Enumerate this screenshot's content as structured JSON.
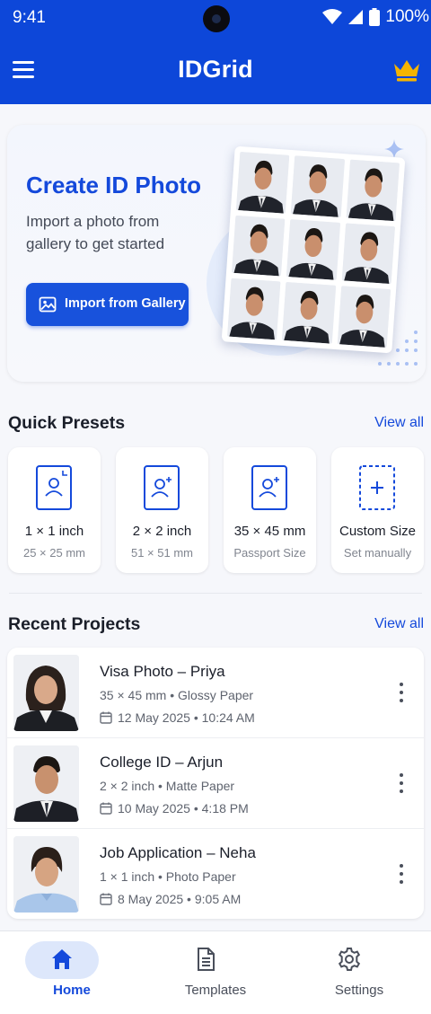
{
  "status": {
    "time": "9:41",
    "battery": "100%"
  },
  "app": {
    "title": "IDGrid"
  },
  "hero": {
    "title": "Create ID Photo",
    "subtitle": "Import a photo from gallery to get started",
    "button_label": "Import from Gallery"
  },
  "quick_presets": {
    "title": "Quick Presets",
    "view_all": "View all",
    "items": [
      {
        "label": "1 × 1 inch",
        "sub": "25 × 25 mm",
        "icon": "portrait-card-icon"
      },
      {
        "label": "2 × 2 inch",
        "sub": "51 × 51 mm",
        "icon": "portrait-add-icon"
      },
      {
        "label": "35 × 45 mm",
        "sub": "Passport Size",
        "icon": "passport-portrait-icon"
      },
      {
        "label": "Custom Size",
        "sub": "Set manually",
        "icon": "dashed-plus-icon"
      }
    ]
  },
  "recent_projects": {
    "title": "Recent Projects",
    "view_all": "View all",
    "items": [
      {
        "title": "Visa Photo – Priya",
        "size": "35 × 45 mm",
        "paper": "Glossy Paper",
        "date": "12 May 2025",
        "time": "10:24 AM"
      },
      {
        "title": "College ID – Arjun",
        "size": "2 × 2 inch",
        "paper": "Matte Paper",
        "date": "10 May 2025",
        "time": "4:18 PM"
      },
      {
        "title": "Job Application – Neha",
        "size": "1 × 1 inch",
        "paper": "Photo Paper",
        "date": "8 May 2025",
        "time": "9:05 AM"
      }
    ]
  },
  "nav": {
    "items": [
      {
        "label": "Home",
        "active": true
      },
      {
        "label": "Templates",
        "active": false
      },
      {
        "label": "Settings",
        "active": false
      }
    ]
  },
  "colors": {
    "primary": "#0d47d9",
    "accent": "#1449db",
    "crown": "#f5b400"
  }
}
